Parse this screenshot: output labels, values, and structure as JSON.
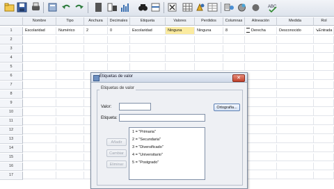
{
  "toolbar": {
    "icons": [
      "open-folder-icon",
      "save-icon",
      "print-icon",
      "dialog-recall-icon",
      "undo-icon",
      "redo-icon",
      "goto-case-icon",
      "goto-variable-icon",
      "variables-icon",
      "find-icon",
      "insert-cases-icon",
      "insert-variable-icon",
      "split-file-icon",
      "weight-cases-icon",
      "select-cases-icon",
      "value-labels-icon",
      "use-sets-icon",
      "show-all-variables-icon",
      "spell-check-icon"
    ]
  },
  "grid": {
    "columns": [
      "Nombre",
      "Tipo",
      "Anchura",
      "Decimales",
      "Etiqueta",
      "Valores",
      "Perdidos",
      "Columnas",
      "Alineación",
      "Medida",
      "Rol"
    ],
    "row_numbers": [
      "1",
      "2",
      "3",
      "4",
      "5",
      "6",
      "7",
      "8",
      "9",
      "10",
      "11",
      "12",
      "13",
      "14",
      "15",
      "16",
      "17"
    ],
    "row1": [
      "Escolaridad",
      "Numérico",
      "2",
      "0",
      "Escolaridad",
      "Ninguna",
      "Ninguna",
      "8",
      "Derecha",
      "Desconocido",
      "Entrada"
    ]
  },
  "dialog": {
    "title": "Etiquetas de valor",
    "group_label": "Etiquetas de valor",
    "value_label": "Valor:",
    "label_label": "Etiqueta:",
    "spelling_button": "Ortografía...",
    "add_button": "Añadir",
    "change_button": "Cambiar",
    "remove_button": "Eliminar",
    "close_glyph": "✕",
    "items": [
      "1 = \"Primaria\"",
      "2 = \"Secundaria\"",
      "3 = \"Diversificado\"",
      "4 = \"Universitario\"",
      "5 = \"Postgrado\""
    ]
  }
}
